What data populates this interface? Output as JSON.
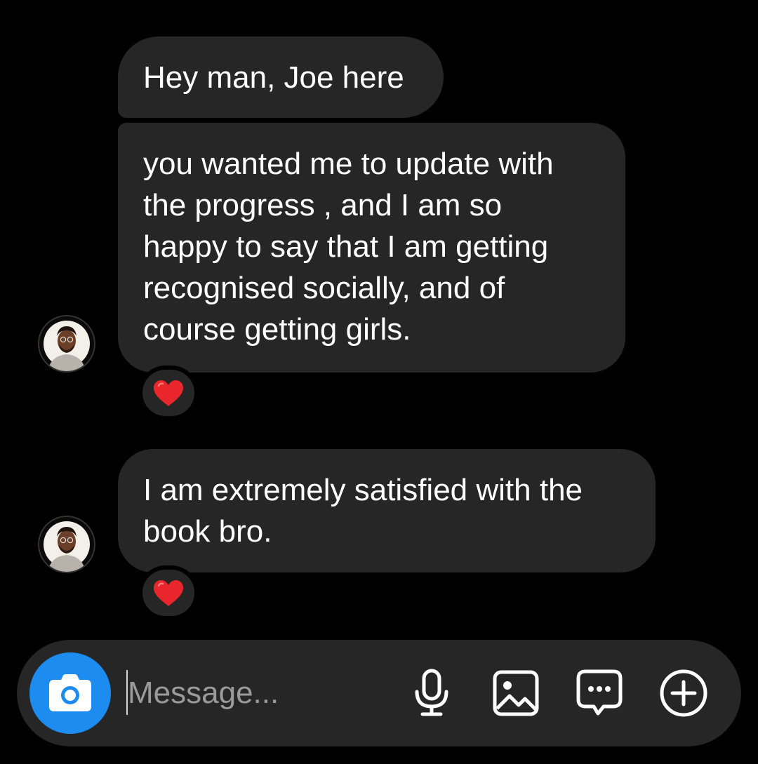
{
  "conversation": {
    "messages": [
      {
        "text": "Hey man, Joe here"
      },
      {
        "text": "you wanted me to update with\nthe progress , and I am so\nhappy to say that I am getting\nrecognised socially, and of\ncourse getting girls.",
        "reaction": "❤️"
      },
      {
        "text": "I am extremely satisfied with the\nbook bro.",
        "reaction": "❤️"
      }
    ],
    "reaction_icon": "red-heart-emoji"
  },
  "composer": {
    "placeholder": "Message...",
    "value": "",
    "icons": [
      "camera-icon",
      "microphone-icon",
      "gallery-icon",
      "sticker-chat-icon",
      "plus-circle-icon"
    ]
  },
  "colors": {
    "background": "#000000",
    "bubble": "#262626",
    "accent_blue": "#1d8cf0",
    "heart_red": "#e8262c"
  }
}
